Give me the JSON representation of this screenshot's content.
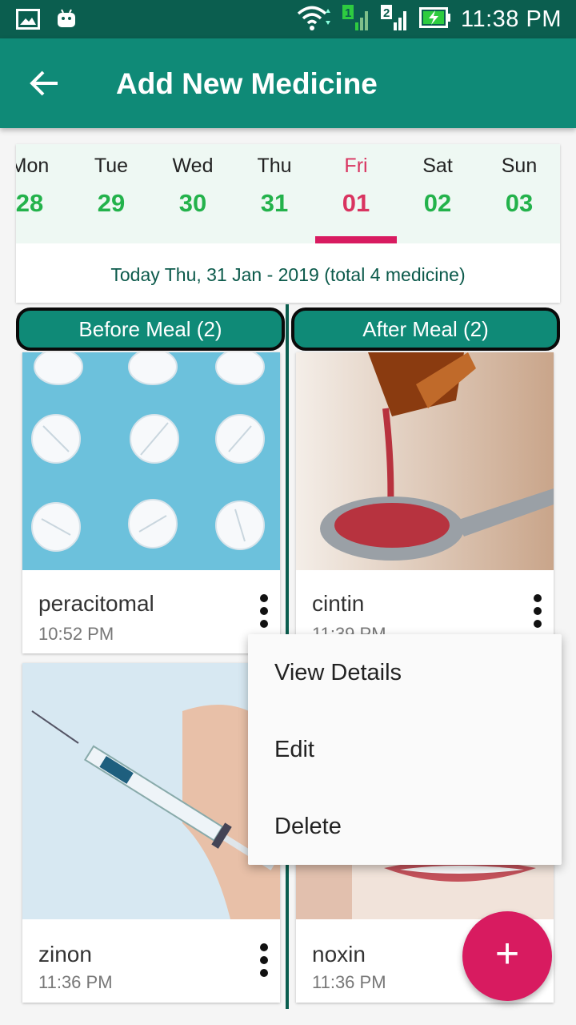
{
  "status_bar": {
    "time": "11:38 PM",
    "sim1_label": "1",
    "sim2_label": "2",
    "icons": [
      "image-icon",
      "android-icon",
      "wifi-icon",
      "signal-icon",
      "signal-icon",
      "battery-charging-icon"
    ]
  },
  "app_bar": {
    "title": "Add New Medicine",
    "back_icon": "arrow-back-icon"
  },
  "calendar": {
    "days": [
      {
        "name": "Mon",
        "num": "28"
      },
      {
        "name": "Tue",
        "num": "29"
      },
      {
        "name": "Wed",
        "num": "30"
      },
      {
        "name": "Thu",
        "num": "31"
      },
      {
        "name": "Fri",
        "num": "01"
      },
      {
        "name": "Sat",
        "num": "02"
      },
      {
        "name": "Sun",
        "num": "03"
      }
    ],
    "selected": "Fri",
    "today_text": "Today Thu, 31 Jan - 2019 (total 4 medicine)"
  },
  "sections": {
    "before_meal": "Before Meal (2)",
    "after_meal": "After Meal (2)"
  },
  "medicines": {
    "before": [
      {
        "name": "peracitomal",
        "time": "10:52 PM"
      },
      {
        "name": "zinon",
        "time": "11:36 PM"
      }
    ],
    "after": [
      {
        "name": "cintin",
        "time": "11:39 PM"
      },
      {
        "name": "noxin",
        "time": "11:36 PM"
      }
    ]
  },
  "popup_menu": {
    "view_details": "View Details",
    "edit": "Edit",
    "delete": "Delete"
  },
  "fab": {
    "label": "+"
  },
  "colors": {
    "status_bar": "#0b5e4f",
    "app_bar": "#0f8a77",
    "accent": "#d81b60",
    "day_number": "#23b24b",
    "calendar_bg": "#eef8f3"
  }
}
